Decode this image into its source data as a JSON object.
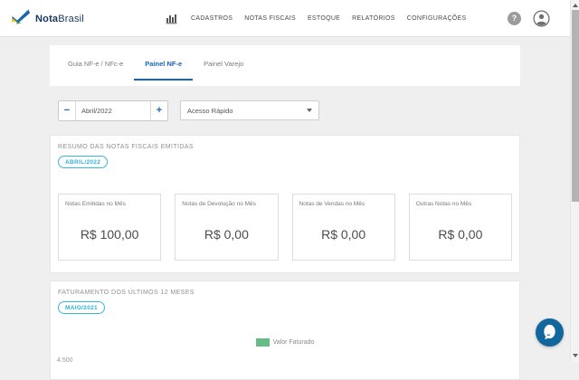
{
  "header": {
    "brand": {
      "bold": "Nota",
      "light": "Brasil"
    },
    "nav_items": [
      "CADASTROS",
      "NOTAS FISCAIS",
      "ESTOQUE",
      "RELATÓRIOS",
      "CONFIGURAÇÕES"
    ],
    "help_glyph": "?"
  },
  "tabs": {
    "items": [
      "Guia NF-e / NFc-e",
      "Painel NF-e",
      "Painel Varejo"
    ],
    "active": "Painel NF-e"
  },
  "period": {
    "minus_label": "−",
    "value": "Abril/2022",
    "plus_label": "+"
  },
  "quick_access": {
    "value": "Acesso Rápido"
  },
  "summary": {
    "title": "RESUMO DAS NOTAS FISCAIS EMITIDAS",
    "badge": "ABRIL/2022",
    "cards": [
      {
        "label": "Notas Emitidas no Mês",
        "value": "R$ 100,00"
      },
      {
        "label": "Notas de Devolução no Mês",
        "value": "R$ 0,00"
      },
      {
        "label": "Notas de Vendas no Mês",
        "value": "R$ 0,00"
      },
      {
        "label": "Outras Notas no Mês",
        "value": "R$ 0,00"
      }
    ]
  },
  "billing": {
    "title": "FATURAMENTO DOS ÚLTIMOS 12 MESES",
    "badge": "MAIO/2021",
    "legend_label": "Valor Faturado",
    "legend_color": "#66bb87",
    "axis_label_partial": "4.500"
  },
  "colors": {
    "accent_blue": "#1565c0",
    "brand_navy": "#16365c",
    "badge_teal": "#2fb2d8",
    "legend_green": "#66bb87",
    "chat_fab_blue": "#11669e"
  }
}
